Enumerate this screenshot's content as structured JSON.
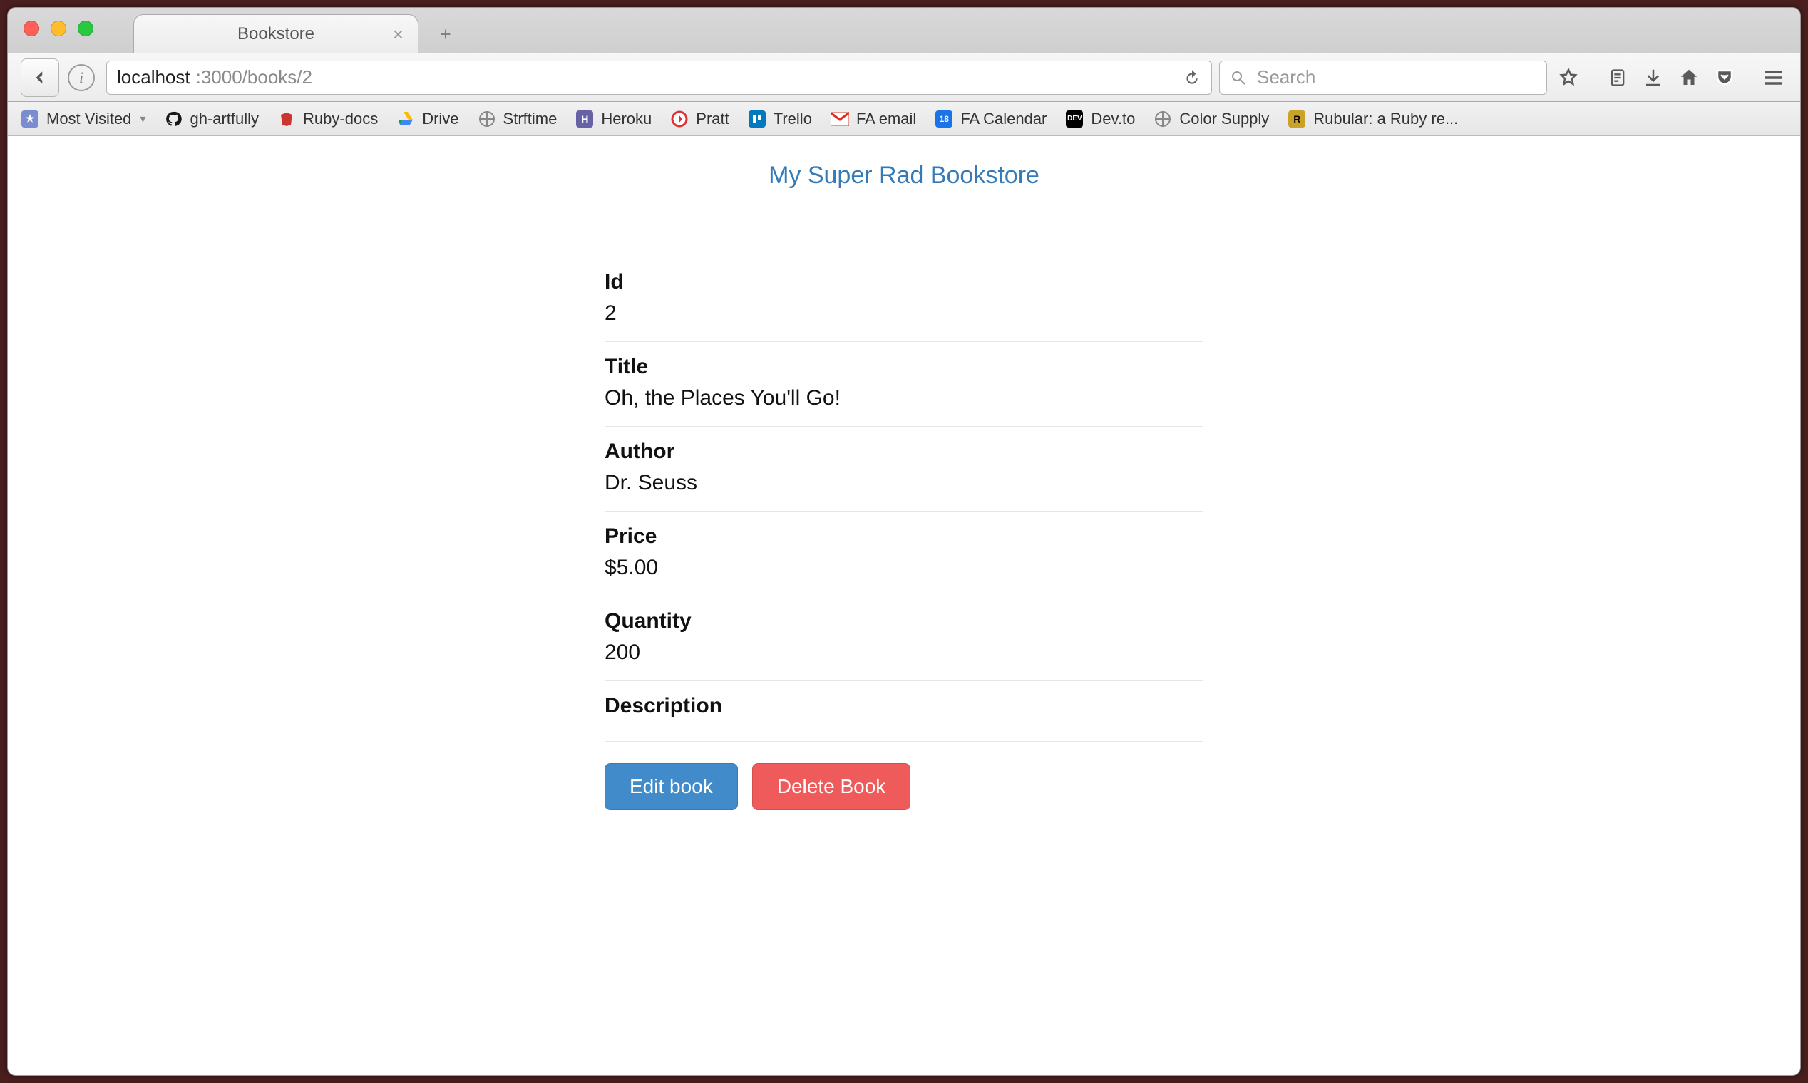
{
  "browser": {
    "tab_title": "Bookstore",
    "url_host": "localhost",
    "url_rest": ":3000/books/2",
    "search_placeholder": "Search"
  },
  "bookmarks": [
    {
      "label": "Most Visited",
      "icon": "folder"
    },
    {
      "label": "gh-artfully",
      "icon": "github"
    },
    {
      "label": "Ruby-docs",
      "icon": "ruby"
    },
    {
      "label": "Drive",
      "icon": "drive"
    },
    {
      "label": "Strftime",
      "icon": "globe"
    },
    {
      "label": "Heroku",
      "icon": "heroku"
    },
    {
      "label": "Pratt",
      "icon": "pratt"
    },
    {
      "label": "Trello",
      "icon": "trello"
    },
    {
      "label": "FA email",
      "icon": "gmail"
    },
    {
      "label": "FA Calendar",
      "icon": "cal"
    },
    {
      "label": "Dev.to",
      "icon": "devto"
    },
    {
      "label": "Color Supply",
      "icon": "globe"
    },
    {
      "label": "Rubular: a Ruby re...",
      "icon": "rubular"
    }
  ],
  "site": {
    "title": "My Super Rad Bookstore"
  },
  "record": {
    "fields": [
      {
        "label": "Id",
        "value": "2"
      },
      {
        "label": "Title",
        "value": "Oh, the Places You'll Go!"
      },
      {
        "label": "Author",
        "value": "Dr. Seuss"
      },
      {
        "label": "Price",
        "value": "$5.00"
      },
      {
        "label": "Quantity",
        "value": "200"
      },
      {
        "label": "Description",
        "value": ""
      }
    ],
    "edit_label": "Edit book",
    "delete_label": "Delete Book"
  }
}
